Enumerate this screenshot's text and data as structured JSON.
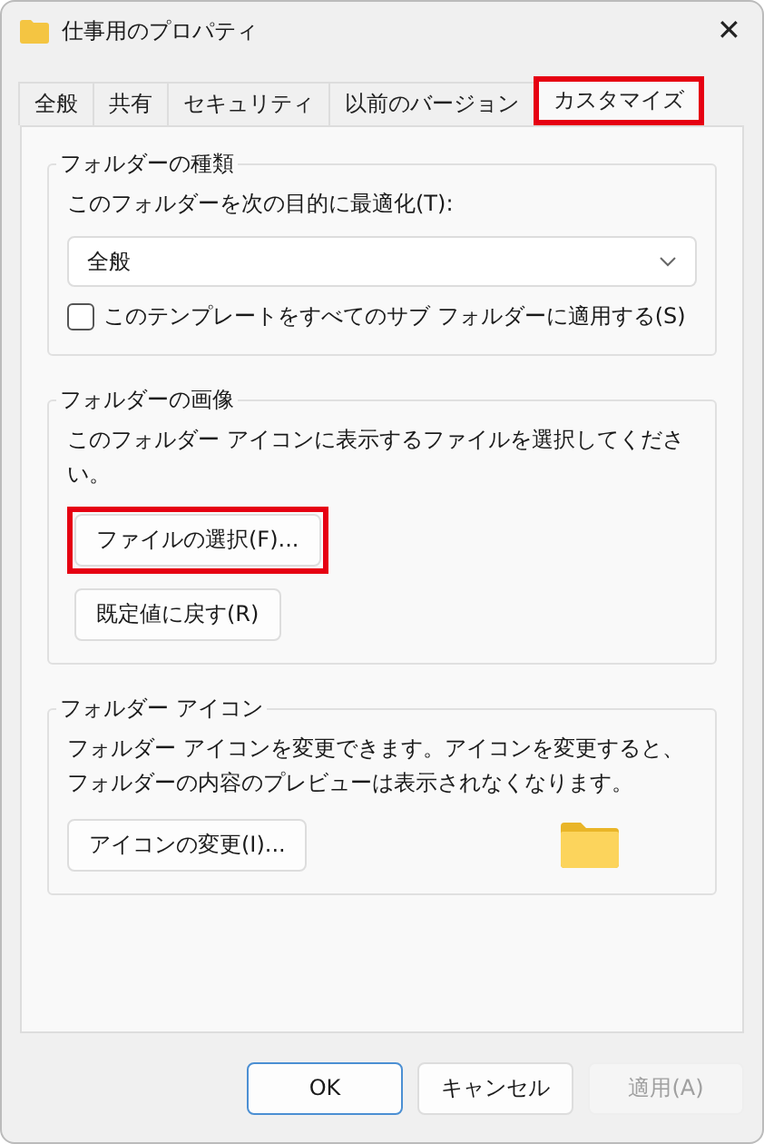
{
  "window": {
    "title": "仕事用のプロパティ",
    "close": "✕"
  },
  "tabs": [
    {
      "label": "全般",
      "selected": false,
      "highlighted": false
    },
    {
      "label": "共有",
      "selected": false,
      "highlighted": false
    },
    {
      "label": "セキュリティ",
      "selected": false,
      "highlighted": false
    },
    {
      "label": "以前のバージョン",
      "selected": false,
      "highlighted": false
    },
    {
      "label": "カスタマイズ",
      "selected": true,
      "highlighted": true
    }
  ],
  "folder_type": {
    "title": "フォルダーの種類",
    "prompt": "このフォルダーを次の目的に最適化(T):",
    "dropdown": {
      "value": "全般"
    },
    "checkbox": {
      "label": "このテンプレートをすべてのサブ フォルダーに適用する(S)",
      "checked": false
    }
  },
  "folder_picture": {
    "title": "フォルダーの画像",
    "text": "このフォルダー アイコンに表示するファイルを選択してください。",
    "buttons": [
      {
        "label": "ファイルの選択(F)...",
        "highlighted": true
      },
      {
        "label": "既定値に戻す(R)",
        "highlighted": false
      }
    ]
  },
  "folder_icon": {
    "title": "フォルダー アイコン",
    "text": "フォルダー アイコンを変更できます。アイコンを変更すると、フォルダーの内容のプレビューは表示されなくなります。",
    "button": "アイコンの変更(I)..."
  },
  "buttons": [
    {
      "label": "OK",
      "kind": "default",
      "disabled": false
    },
    {
      "label": "キャンセル",
      "kind": "normal",
      "disabled": false
    },
    {
      "label": "適用(A)",
      "kind": "normal",
      "disabled": true
    }
  ]
}
